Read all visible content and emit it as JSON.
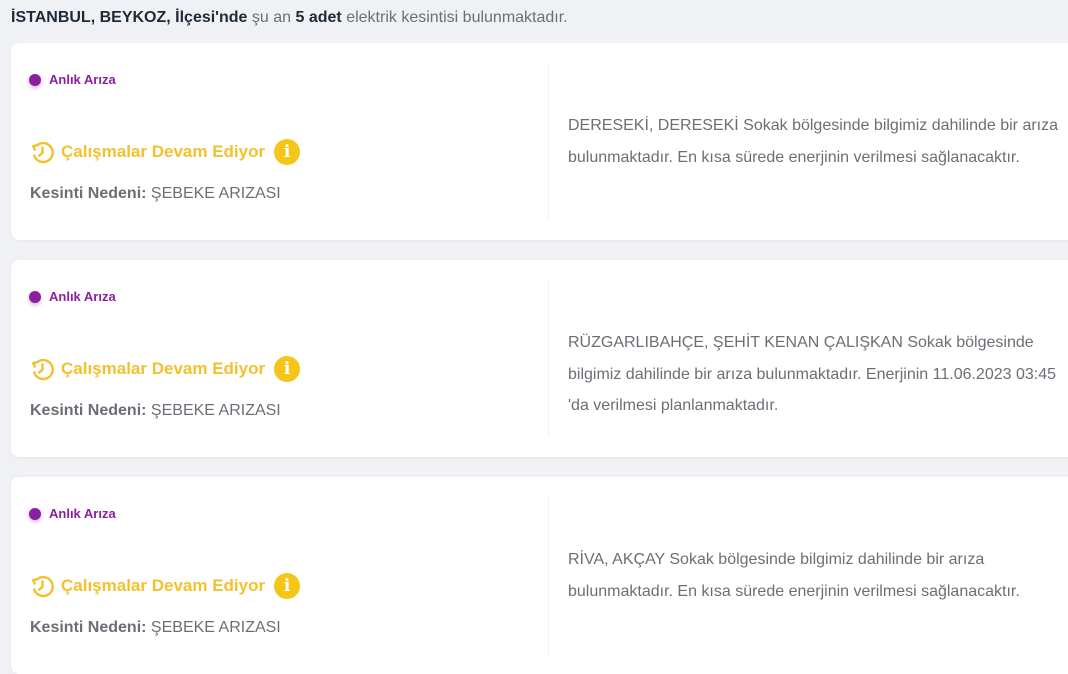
{
  "summary": {
    "location": "İSTANBUL, BEYKOZ, İlçesi'nde",
    "pre_count": "şu an",
    "count": "5 adet",
    "post_count": "elektrik kesintisi bulunmaktadır."
  },
  "colors": {
    "tag": "#8a1fa0",
    "status": "#f2c12e",
    "info": "#f5c518"
  },
  "outages": [
    {
      "tag": "Anlık Arıza",
      "status": "Çalışmalar Devam Ediyor",
      "status_icon": "clock-rotate-icon",
      "info_icon_glyph": "i",
      "reason_label": "Kesinti Nedeni:",
      "reason_value": "ŞEBEKE ARIZASI",
      "message": "DERESEKİ, DERESEKİ Sokak bölgesinde bilgimiz dahilinde bir arıza bulunmaktadır. En kısa sürede enerjinin verilmesi sağlanacaktır."
    },
    {
      "tag": "Anlık Arıza",
      "status": "Çalışmalar Devam Ediyor",
      "status_icon": "clock-rotate-icon",
      "info_icon_glyph": "i",
      "reason_label": "Kesinti Nedeni:",
      "reason_value": "ŞEBEKE ARIZASI",
      "message": "RÜZGARLIBAHÇE, ŞEHİT KENAN ÇALIŞKAN Sokak bölgesinde bilgimiz dahilinde bir arıza bulunmaktadır. Enerjinin 11.06.2023 03:45 'da verilmesi planlanmaktadır."
    },
    {
      "tag": "Anlık Arıza",
      "status": "Çalışmalar Devam Ediyor",
      "status_icon": "clock-rotate-icon",
      "info_icon_glyph": "i",
      "reason_label": "Kesinti Nedeni:",
      "reason_value": "ŞEBEKE ARIZASI",
      "message": "RİVA, AKÇAY Sokak bölgesinde bilgimiz dahilinde bir arıza bulunmaktadır. En kısa sürede enerjinin verilmesi sağlanacaktır."
    }
  ]
}
